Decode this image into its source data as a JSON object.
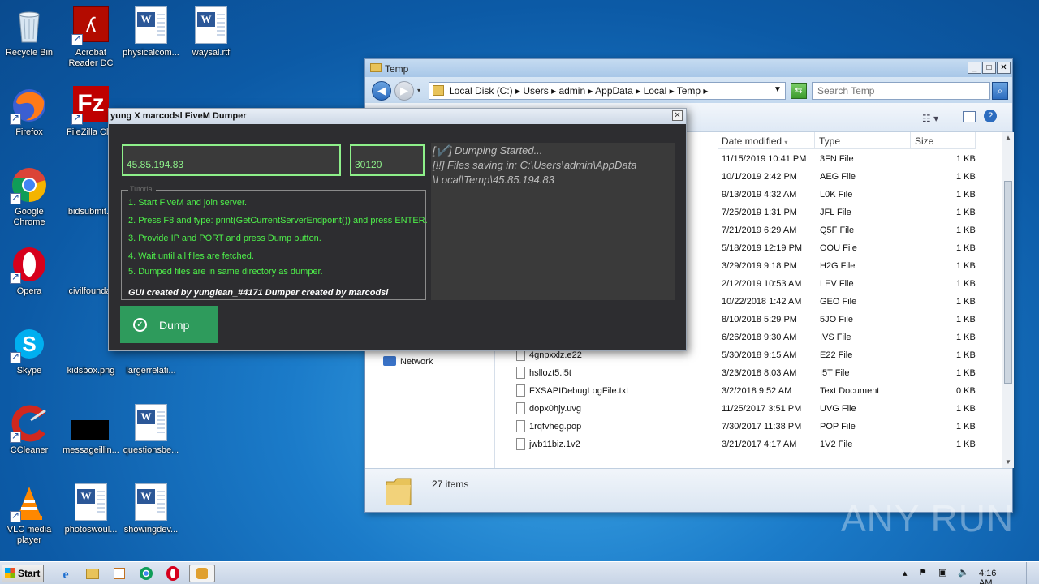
{
  "desktop": {
    "icons": [
      {
        "label": "Recycle Bin",
        "icon": "recycle-bin"
      },
      {
        "label": "Acrobat Reader DC",
        "icon": "acrobat"
      },
      {
        "label": "physicalcom...",
        "icon": "word-doc"
      },
      {
        "label": "waysal.rtf",
        "icon": "word-doc"
      },
      {
        "label": "Firefox",
        "icon": "firefox"
      },
      {
        "label": "FileZilla Clie",
        "icon": "filezilla"
      },
      {
        "label": "Google Chrome",
        "icon": "chrome"
      },
      {
        "label": "bidsubmit.p",
        "icon": "file"
      },
      {
        "label": "Opera",
        "icon": "opera"
      },
      {
        "label": "civilfoundat",
        "icon": "file"
      },
      {
        "label": "Skype",
        "icon": "skype"
      },
      {
        "label": "kidsbox.png",
        "icon": "image"
      },
      {
        "label": "largerrelati...",
        "icon": "file"
      },
      {
        "label": "CCleaner",
        "icon": "ccleaner"
      },
      {
        "label": "messageillin...",
        "icon": "image"
      },
      {
        "label": "questionsbe...",
        "icon": "word-doc"
      },
      {
        "label": "VLC media player",
        "icon": "vlc"
      },
      {
        "label": "photoswoul...",
        "icon": "word-doc"
      },
      {
        "label": "showingdev...",
        "icon": "word-doc"
      }
    ]
  },
  "explorer": {
    "title": "Temp",
    "breadcrumbs": [
      "Local Disk (C:)",
      "Users",
      "admin",
      "AppData",
      "Local",
      "Temp"
    ],
    "search_placeholder": "Search Temp",
    "columns": {
      "date": "Date modified",
      "type": "Type",
      "size": "Size"
    },
    "nav_network": "Network",
    "rows": [
      {
        "name": "",
        "date": "11/15/2019 10:41 PM",
        "type": "3FN File",
        "size": "1 KB"
      },
      {
        "name": "",
        "date": "10/1/2019 2:42 PM",
        "type": "AEG File",
        "size": "1 KB"
      },
      {
        "name": "",
        "date": "9/13/2019 4:32 AM",
        "type": "L0K File",
        "size": "1 KB"
      },
      {
        "name": "",
        "date": "7/25/2019 1:31 PM",
        "type": "JFL File",
        "size": "1 KB"
      },
      {
        "name": "",
        "date": "7/21/2019 6:29 AM",
        "type": "Q5F File",
        "size": "1 KB"
      },
      {
        "name": "",
        "date": "5/18/2019 12:19 PM",
        "type": "OOU File",
        "size": "1 KB"
      },
      {
        "name": "",
        "date": "3/29/2019 9:18 PM",
        "type": "H2G File",
        "size": "1 KB"
      },
      {
        "name": "",
        "date": "2/12/2019 10:53 AM",
        "type": "LEV File",
        "size": "1 KB"
      },
      {
        "name": "",
        "date": "10/22/2018 1:42 AM",
        "type": "GEO File",
        "size": "1 KB"
      },
      {
        "name": "",
        "date": "8/10/2018 5:29 PM",
        "type": "5JO File",
        "size": "1 KB"
      },
      {
        "name": "",
        "date": "6/26/2018 9:30 AM",
        "type": "IVS File",
        "size": "1 KB"
      },
      {
        "name": "4gnpxxlz.e22",
        "date": "5/30/2018 9:15 AM",
        "type": "E22 File",
        "size": "1 KB"
      },
      {
        "name": "hsllozt5.i5t",
        "date": "3/23/2018 8:03 AM",
        "type": "I5T File",
        "size": "1 KB"
      },
      {
        "name": "FXSAPIDebugLogFile.txt",
        "date": "3/2/2018 9:52 AM",
        "type": "Text Document",
        "size": "0 KB"
      },
      {
        "name": "dopx0hjy.uvg",
        "date": "11/25/2017 3:51 PM",
        "type": "UVG File",
        "size": "1 KB"
      },
      {
        "name": "1rqfvheg.pop",
        "date": "7/30/2017 11:38 PM",
        "type": "POP File",
        "size": "1 KB"
      },
      {
        "name": "jwb11biz.1v2",
        "date": "3/21/2017 4:17 AM",
        "type": "1V2 File",
        "size": "1 KB"
      }
    ],
    "status": "27 items"
  },
  "dumper": {
    "title": "yung X marcodsl FiveM Dumper",
    "ip_value": "45.85.194.83",
    "port_value": "30120",
    "tutorial_legend": "Tutorial",
    "steps": [
      "1. Start FiveM and join server.",
      "2. Press F8 and type: print(GetCurrentServerEndpoint()) and press ENTER.",
      "3. Provide IP and PORT and press Dump button.",
      "4. Wait until all files are fetched.",
      "5. Dumped files are in same directory as dumper."
    ],
    "credits": "GUI created by yunglean_#4171 Dumper created by marcodsl",
    "log": [
      "[✔️] Dumping Started...",
      "[!!] Files saving in: C:\\Users\\admin\\AppData",
      "\\Local\\Temp\\45.85.194.83"
    ],
    "dump_label": "Dump"
  },
  "taskbar": {
    "start_label": "Start",
    "clock": "4:16 AM"
  },
  "watermark": "ANY RUN"
}
